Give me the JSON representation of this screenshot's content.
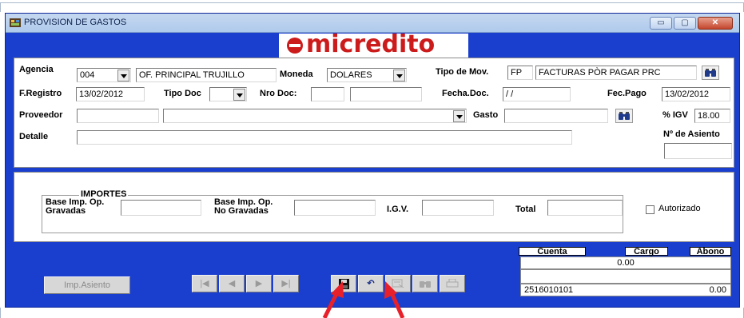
{
  "window": {
    "title": "PROVISION DE GASTOS",
    "minimize_glyph": "▭",
    "maximize_glyph": "▢",
    "close_glyph": "✕"
  },
  "logo": {
    "text": "micredito",
    "color": "#cc1b1b"
  },
  "form": {
    "agencia_label": "Agencia",
    "agencia_code": "004",
    "agencia_name": "OF. PRINCIPAL TRUJILLO",
    "moneda_label": "Moneda",
    "moneda_value": "DOLARES",
    "tipo_mov_label": "Tipo de Mov.",
    "tipo_mov_code": "FP",
    "tipo_mov_desc": "FACTURAS PÒR PAGAR PRC",
    "fregistro_label": "F.Registro",
    "fregistro_value": "13/02/2012",
    "tipo_doc_label": "Tipo Doc",
    "tipo_doc_value": "",
    "nro_doc_label": "Nro Doc:",
    "nro_doc_serie": "",
    "nro_doc_numero": "",
    "fecha_doc_label": "Fecha.Doc.",
    "fecha_doc_value": "/ /",
    "fec_pago_label": "Fec.Pago",
    "fec_pago_value": "13/02/2012",
    "proveedor_label": "Proveedor",
    "proveedor_code": "",
    "proveedor_name": "",
    "gasto_label": "Gasto",
    "gasto_value": "",
    "igv_label": "% IGV",
    "igv_value": "18.00",
    "detalle_label": "Detalle",
    "detalle_value": "",
    "asiento_label": "Nº de Asiento",
    "asiento_value": ""
  },
  "importes": {
    "group_label": "IMPORTES",
    "base_gravadas_label_1": "Base Imp. Op.",
    "base_gravadas_label_2": "Gravadas",
    "base_gravadas_value": "",
    "base_no_gravadas_label_1": "Base Imp. Op.",
    "base_no_gravadas_label_2": "No Gravadas",
    "base_no_gravadas_value": "",
    "igv_label": "I.G.V.",
    "igv_value": "",
    "total_label": "Total",
    "total_value": "",
    "autorizado_label": "Autorizado",
    "autorizado_checked": false
  },
  "toolbar": {
    "imp_asiento_label": "Imp.Asiento",
    "first_glyph": "|◀",
    "prev_glyph": "◀",
    "next_glyph": "▶",
    "last_glyph": "▶|",
    "save_glyph": "💾",
    "undo_glyph": "↶"
  },
  "grid": {
    "headers": [
      "Cuenta",
      "Cargo",
      "Abono"
    ],
    "total_cargo": "0.00",
    "row_cuenta": "2516010101",
    "row_abono": "0.00"
  },
  "colors": {
    "window_bg": "#1a3fcf",
    "arrow": "#e8202a"
  }
}
